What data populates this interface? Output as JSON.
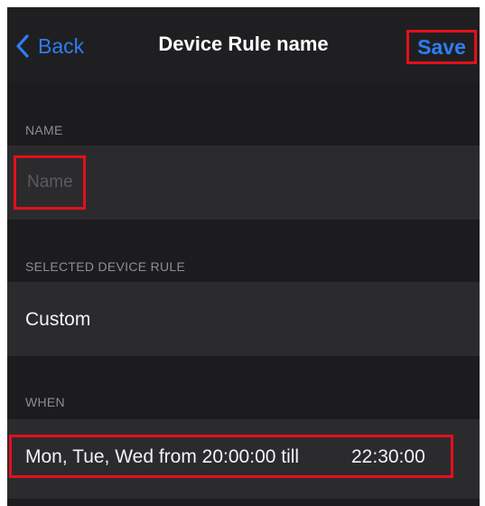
{
  "navbar": {
    "back_label": "Back",
    "title": "Device Rule name",
    "save_label": "Save"
  },
  "name_section": {
    "header": "NAME",
    "input_placeholder": "Name",
    "input_value": ""
  },
  "device_rule_section": {
    "header": "SELECTED DEVICE RULE",
    "value": "Custom"
  },
  "when_section": {
    "header": "WHEN",
    "schedule_text": "Mon, Tue, Wed from 20:00:00 till",
    "end_time": "22:30:00"
  },
  "colors": {
    "accent": "#2f7cf6",
    "highlight_border": "#e3101b",
    "background": "#1c1c1e",
    "cell_background": "#2b2b2e",
    "secondary_text": "#8e8e93"
  },
  "icons": {
    "back": "chevron-left-icon"
  }
}
